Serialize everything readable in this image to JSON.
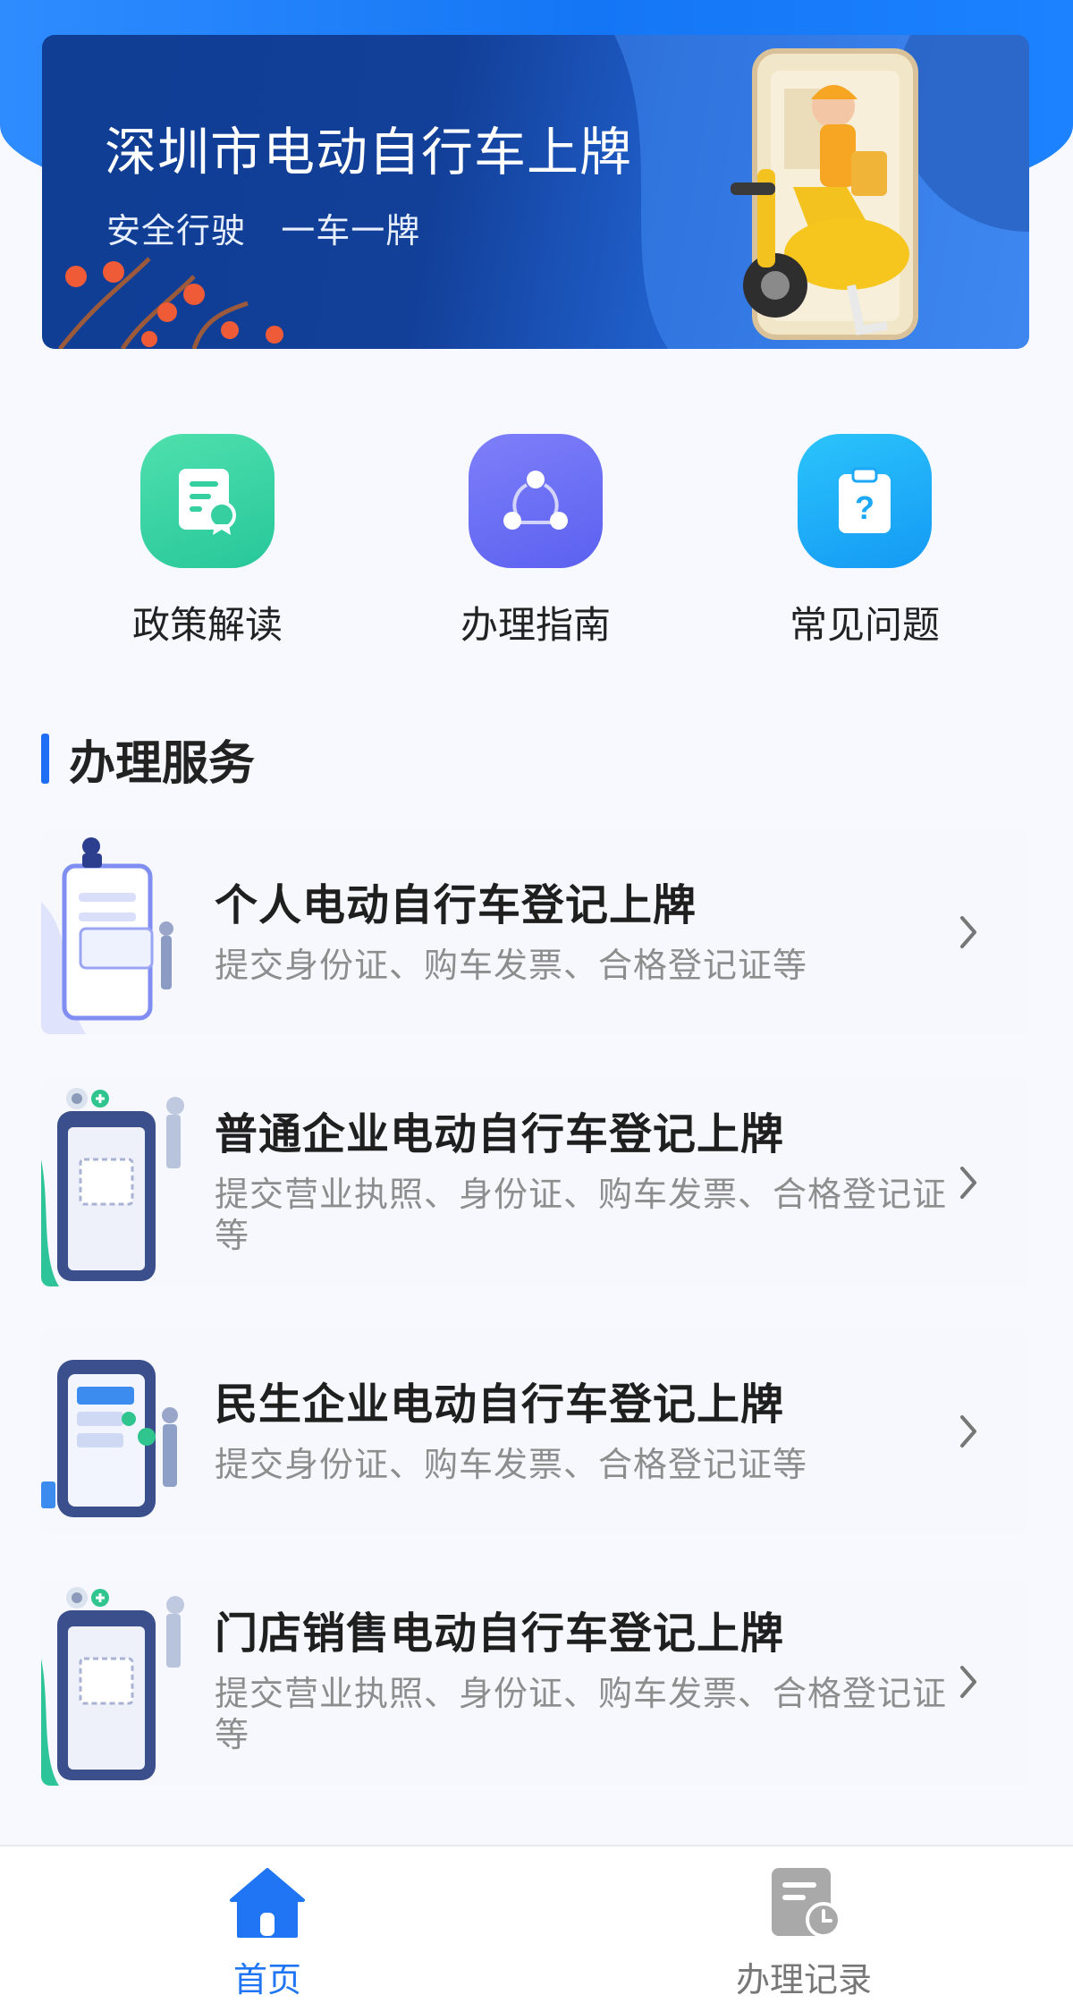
{
  "banner": {
    "title": "深圳市电动自行车上牌",
    "subtitle": "安全行驶   一车一牌"
  },
  "quick_links": [
    {
      "label": "政策解读",
      "icon": "certificate-document-icon"
    },
    {
      "label": "办理指南",
      "icon": "share-nodes-icon"
    },
    {
      "label": "常见问题",
      "icon": "question-clipboard-icon"
    }
  ],
  "section": {
    "title": "办理服务"
  },
  "services": [
    {
      "title": "个人电动自行车登记上牌",
      "desc": "提交身份证、购车发票、合格登记证等"
    },
    {
      "title": "普通企业电动自行车登记上牌",
      "desc": "提交营业执照、身份证、购车发票、合格登记证等"
    },
    {
      "title": "民生企业电动自行车登记上牌",
      "desc": "提交身份证、购车发票、合格登记证等"
    },
    {
      "title": "门店销售电动自行车登记上牌",
      "desc": "提交营业执照、身份证、购车发票、合格登记证等"
    }
  ],
  "tabbar": {
    "home": "首页",
    "records": "办理记录"
  },
  "colors": {
    "primary": "#1f75f3",
    "banner_dark": "#123f98",
    "green": "#2fcf9f",
    "purple": "#6468f3",
    "cyan": "#1da7f7"
  }
}
